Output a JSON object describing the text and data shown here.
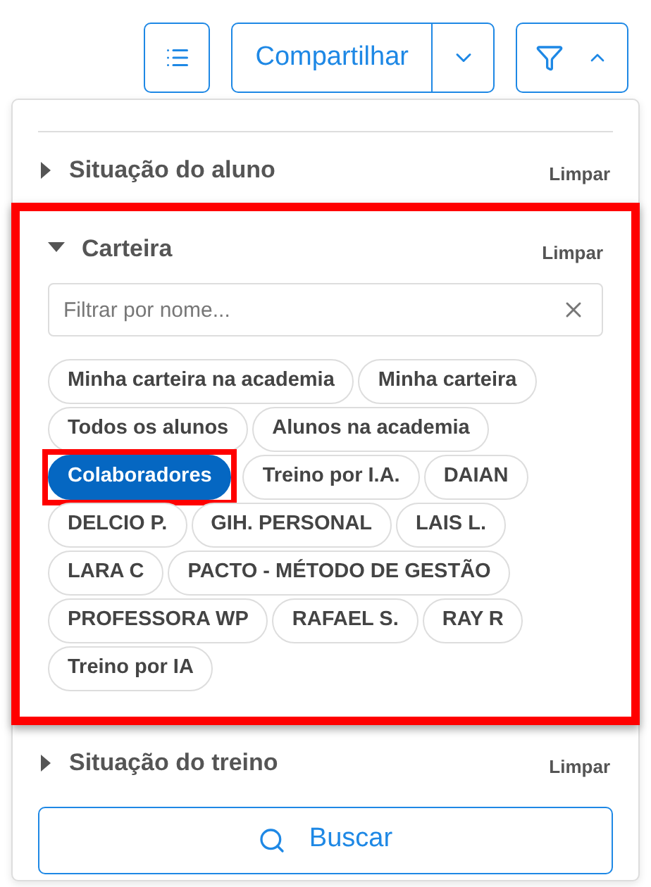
{
  "toolbar": {
    "share_label": "Compartilhar"
  },
  "filter_panel": {
    "sections": [
      {
        "title": "Situação do aluno",
        "clear_label": "Limpar",
        "expanded": false,
        "highlighted": false
      },
      {
        "title": "Carteira",
        "clear_label": "Limpar",
        "expanded": true,
        "highlighted": true,
        "search": {
          "placeholder": "Filtrar por nome..."
        },
        "chips": [
          {
            "label": "Minha carteira na academia",
            "selected": false,
            "highlighted": false
          },
          {
            "label": "Minha carteira",
            "selected": false,
            "highlighted": false
          },
          {
            "label": "Todos os alunos",
            "selected": false,
            "highlighted": false
          },
          {
            "label": "Alunos na academia",
            "selected": false,
            "highlighted": false
          },
          {
            "label": "Colaboradores",
            "selected": true,
            "highlighted": true
          },
          {
            "label": "Treino por I.A.",
            "selected": false,
            "highlighted": false
          },
          {
            "label": "DAIAN",
            "selected": false,
            "highlighted": false
          },
          {
            "label": "DELCIO P.",
            "selected": false,
            "highlighted": false
          },
          {
            "label": "GIH. PERSONAL",
            "selected": false,
            "highlighted": false
          },
          {
            "label": "LAIS L.",
            "selected": false,
            "highlighted": false
          },
          {
            "label": "LARA C",
            "selected": false,
            "highlighted": false
          },
          {
            "label": "PACTO - MÉTODO DE GESTÃO",
            "selected": false,
            "highlighted": false
          },
          {
            "label": "PROFESSORA WP",
            "selected": false,
            "highlighted": false
          },
          {
            "label": "RAFAEL S.",
            "selected": false,
            "highlighted": false
          },
          {
            "label": "RAY R",
            "selected": false,
            "highlighted": false
          },
          {
            "label": "Treino por IA",
            "selected": false,
            "highlighted": false
          }
        ]
      },
      {
        "title": "Situação do treino",
        "clear_label": "Limpar",
        "expanded": false,
        "highlighted": false
      }
    ],
    "search_button": "Buscar"
  }
}
